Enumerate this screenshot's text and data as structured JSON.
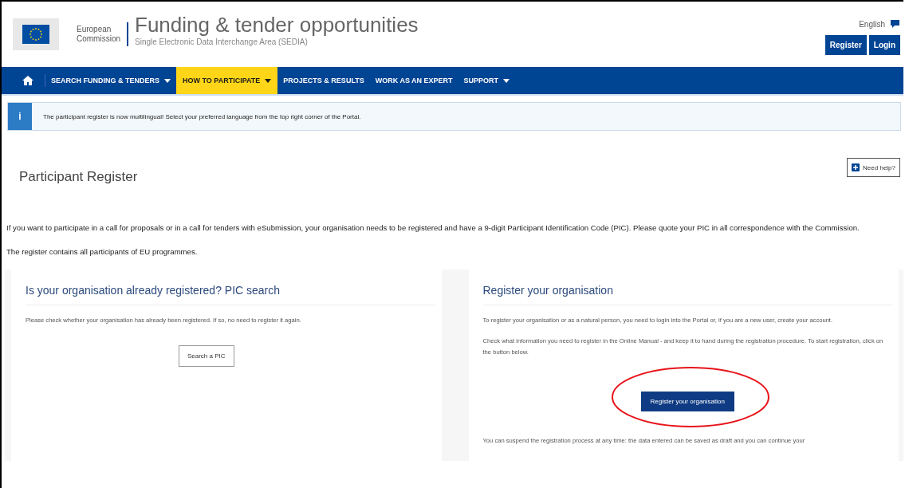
{
  "header": {
    "logo_text": [
      "European",
      "Commission"
    ],
    "title": "Funding & tender opportunities",
    "subtitle": "Single Electronic Data Interchange Area (SEDIA)",
    "language": "English",
    "buttons": [
      "Register",
      "Login"
    ]
  },
  "nav": [
    {
      "label": "SEARCH FUNDING & TENDERS",
      "dropdown": true,
      "selected": false
    },
    {
      "label": "HOW TO PARTICIPATE",
      "dropdown": true,
      "selected": true
    },
    {
      "label": "PROJECTS & RESULTS",
      "dropdown": false,
      "selected": false
    },
    {
      "label": "WORK AS AN EXPERT",
      "dropdown": false,
      "selected": false
    },
    {
      "label": "SUPPORT",
      "dropdown": true,
      "selected": false
    }
  ],
  "info_icon": "i",
  "info_message": "The participant register is now multilingual! Select your preferred language from the top right corner of the Portal.",
  "page_title": "Participant Register",
  "help_button": "Need help?",
  "intro": [
    "If you want to participate in a call for proposals or in a call for tenders with eSubmission, your organisation needs to be registered and have a 9-digit Participant Identification Code (PIC). Please quote your PIC in all correspondence with the Commission.",
    "The register contains all participants of EU programmes."
  ],
  "cards": [
    {
      "title": "Is your organisation already registered? PIC search",
      "paragraphs": [
        "Please check whether your organisation has already been registered. If so, no need to register it again."
      ],
      "button": {
        "label": "Search a PIC",
        "kind": "secondary"
      },
      "highlighted": false
    },
    {
      "title": "Register your organisation",
      "paragraphs": [
        "To register your organisation or as a natural person, you need to login into the Portal or, if you are a new user, create your account.",
        "Check what information you need to register in the Online Manual - and keep it to hand during the registration procedure. To start registration, click on the button below."
      ],
      "button": {
        "label": "Register your organisation",
        "kind": "primary"
      },
      "highlighted": true,
      "footer": "You can suspend the registration process at any time: the data entered can be saved as draft and you can continue your"
    }
  ]
}
